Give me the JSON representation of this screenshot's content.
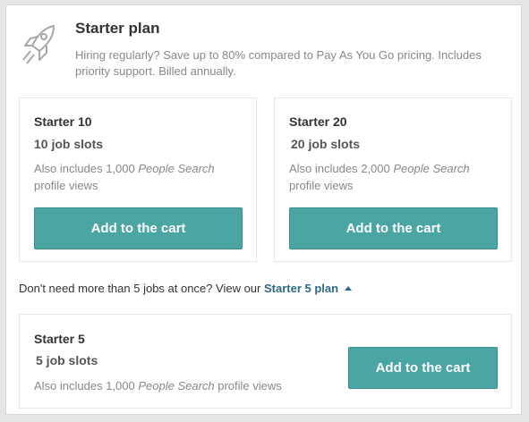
{
  "header": {
    "title": "Starter plan",
    "description": "Hiring regularly? Save up to 80% compared to Pay As You Go pricing. Includes priority support. Billed annually.",
    "icon": "rocket-icon"
  },
  "plans": [
    {
      "name": "Starter 10",
      "slots": "10 job slots",
      "views_prefix": "Also includes 1,000 ",
      "views_em": "People Search",
      "views_suffix": " profile views",
      "button": "Add to the cart"
    },
    {
      "name": "Starter 20",
      "slots": "20 job slots",
      "views_prefix": "Also includes 2,000 ",
      "views_em": "People Search",
      "views_suffix": " profile views",
      "button": "Add to the cart"
    }
  ],
  "note": {
    "text": "Don't need more than 5 jobs at once? View our ",
    "link": "Starter 5 plan"
  },
  "starter5": {
    "name": "Starter 5",
    "slots": "5 job slots",
    "views_prefix": "Also includes 1,000 ",
    "views_em": "People Search",
    "views_suffix": " profile views",
    "button": "Add to the cart"
  },
  "colors": {
    "accent": "#4aa5a3",
    "link": "#2d6a89"
  }
}
